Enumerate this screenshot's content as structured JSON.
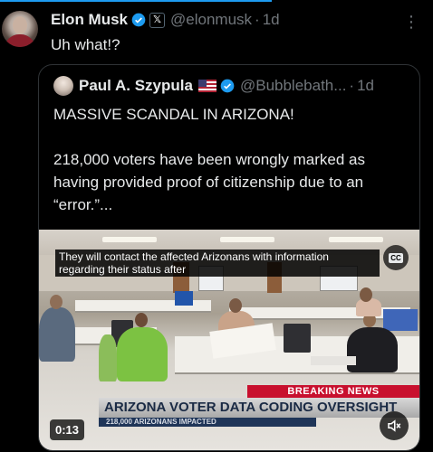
{
  "post": {
    "author_name": "Elon Musk",
    "handle": "@elonmusk",
    "separator": "·",
    "time": "1d",
    "affiliate_badge": "𝕏",
    "text": "Uh what!?",
    "more_icon": "⋮"
  },
  "quoted": {
    "author_name": "Paul A. Szypula",
    "handle": "@Bubblebath...",
    "separator": "·",
    "time": "1d",
    "paragraph1": "MASSIVE SCANDAL IN ARIZONA!",
    "paragraph2": "218,000 voters have been wrongly marked as having provided proof of citizenship due to an “error.”...",
    "video": {
      "caption": "They will contact the affected Arizonans with information regarding their status after",
      "cc_label": "CC",
      "breaking": "BREAKING NEWS",
      "headline": "ARIZONA VOTER DATA CODING OVERSIGHT",
      "subheadline": "218,000 ARIZONANS IMPACTED",
      "duration": "0:13"
    }
  },
  "colors": {
    "accent": "#1d9bf0",
    "background": "#000000",
    "secondary_text": "#71767b",
    "breaking_red": "#c8102e"
  }
}
